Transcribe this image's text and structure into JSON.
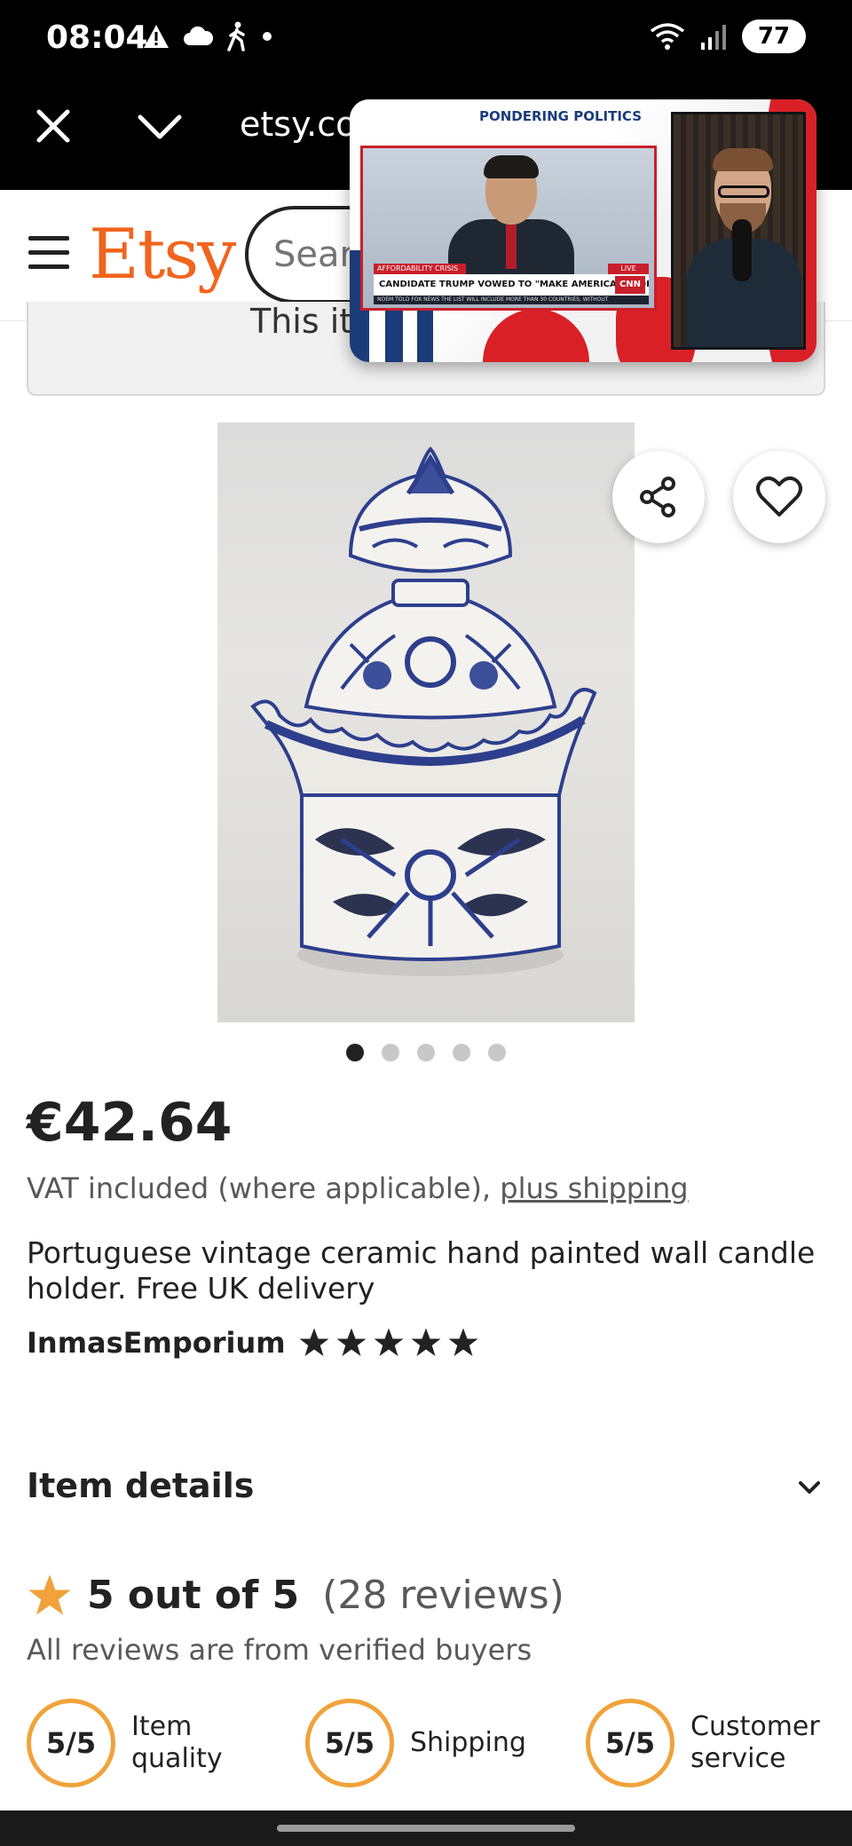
{
  "status_bar": {
    "time": "08:04",
    "battery": "77",
    "icons_left": [
      "warning-icon",
      "cloud-icon",
      "walking-icon",
      "dot-icon"
    ],
    "icons_right": [
      "wifi-icon",
      "signal-icon",
      "battery-icon"
    ]
  },
  "browser": {
    "url": "etsy.co"
  },
  "header": {
    "logo": "Etsy",
    "logo_color": "#F1641E",
    "search_placeholder": "Sear"
  },
  "banner": {
    "text": "This it"
  },
  "pip": {
    "show_title": "PONDERING POLITICS",
    "lower_third_tag": "AFFORDABILITY CRISIS",
    "headline": "CANDIDATE TRUMP VOWED TO \"MAKE AMERICA AFFORDABLE AGAIN\"",
    "live": "LIVE",
    "network": "CNN",
    "ticker": "NOEM TOLD FOX NEWS THE LIST WILL INCLUDE MORE THAN 30 COUNTRIES, WITHOUT"
  },
  "product": {
    "image_alt": "Blue and white hand painted ceramic candle holder",
    "image_count": 5,
    "active_image": 1,
    "price": "€42.64",
    "vat_text": "VAT included (where applicable),",
    "shipping_link": "plus shipping",
    "title": "Portuguese vintage ceramic hand painted wall candle holder. Free UK delivery",
    "shop_name": "InmasEmporium",
    "shop_rating_stars": 5
  },
  "item_details": {
    "label": "Item details"
  },
  "reviews": {
    "rating_text": "5 out of 5",
    "count_text": "(28 reviews)",
    "verified_text": "All reviews are from verified buyers",
    "star_color": "#F1A23A",
    "scores": [
      {
        "value": "5/5",
        "label": "Item quality"
      },
      {
        "value": "5/5",
        "label": "Shipping"
      },
      {
        "value": "5/5",
        "label": "Customer service"
      }
    ]
  }
}
